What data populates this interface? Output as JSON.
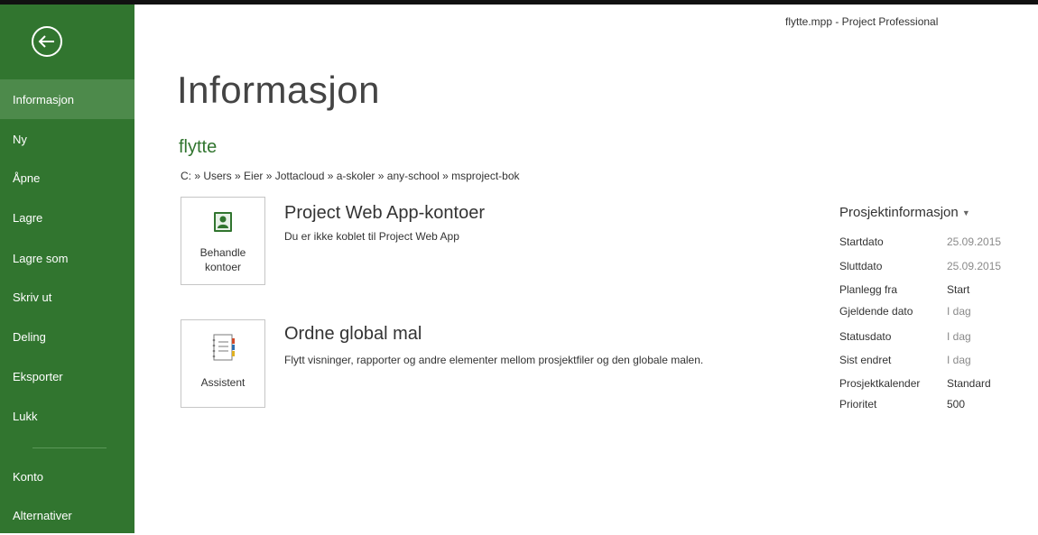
{
  "window": {
    "title": "flytte.mpp - Project Professional"
  },
  "sidebar": {
    "back_icon": "back-arrow-icon",
    "items": [
      {
        "label": "Informasjon",
        "active": true
      },
      {
        "label": "Ny"
      },
      {
        "label": "Åpne"
      },
      {
        "label": "Lagre"
      },
      {
        "label": "Lagre som"
      },
      {
        "label": "Skriv ut"
      },
      {
        "label": "Deling"
      },
      {
        "label": "Eksporter"
      },
      {
        "label": "Lukk"
      }
    ],
    "bottom_items": [
      {
        "label": "Konto"
      },
      {
        "label": "Alternativer"
      }
    ],
    "colors": {
      "background": "#31752f",
      "active": "#4d8a4b"
    }
  },
  "main": {
    "title": "Informasjon",
    "file_name": "flytte",
    "path": "C: » Users » Eier » Jottacloud » a-skoler » any-school » msproject-bok",
    "sections": [
      {
        "button_label_line1": "Behandle",
        "button_label_line2": "kontoer",
        "icon": "contact-card-icon",
        "heading": "Project Web App-kontoer",
        "description": "Du er ikke koblet til Project Web App"
      },
      {
        "button_label": "Assistent",
        "icon": "notebook-icon",
        "heading": "Ordne global mal",
        "description": "Flytt visninger, rapporter og andre elementer mellom prosjektfiler og den globale malen."
      }
    ]
  },
  "project_info": {
    "title": "Prosjektinformasjon",
    "dropdown_icon": "caret-down-icon",
    "rows": [
      {
        "label": "Startdato",
        "value": "25.09.2015"
      },
      {
        "label": "Sluttdato",
        "value": "25.09.2015"
      },
      {
        "label": "Planlegg fra",
        "value": "Start"
      },
      {
        "label": "Gjeldende dato",
        "value": "I dag"
      },
      {
        "label": "Statusdato",
        "value": "I dag"
      },
      {
        "label": "Sist endret",
        "value": "I dag"
      },
      {
        "label": "Prosjektkalender",
        "value": "Standard"
      },
      {
        "label": "Prioritet",
        "value": "500"
      }
    ]
  },
  "colors": {
    "accent": "#31752f",
    "text": "#333333",
    "muted": "#8a8a8a"
  }
}
